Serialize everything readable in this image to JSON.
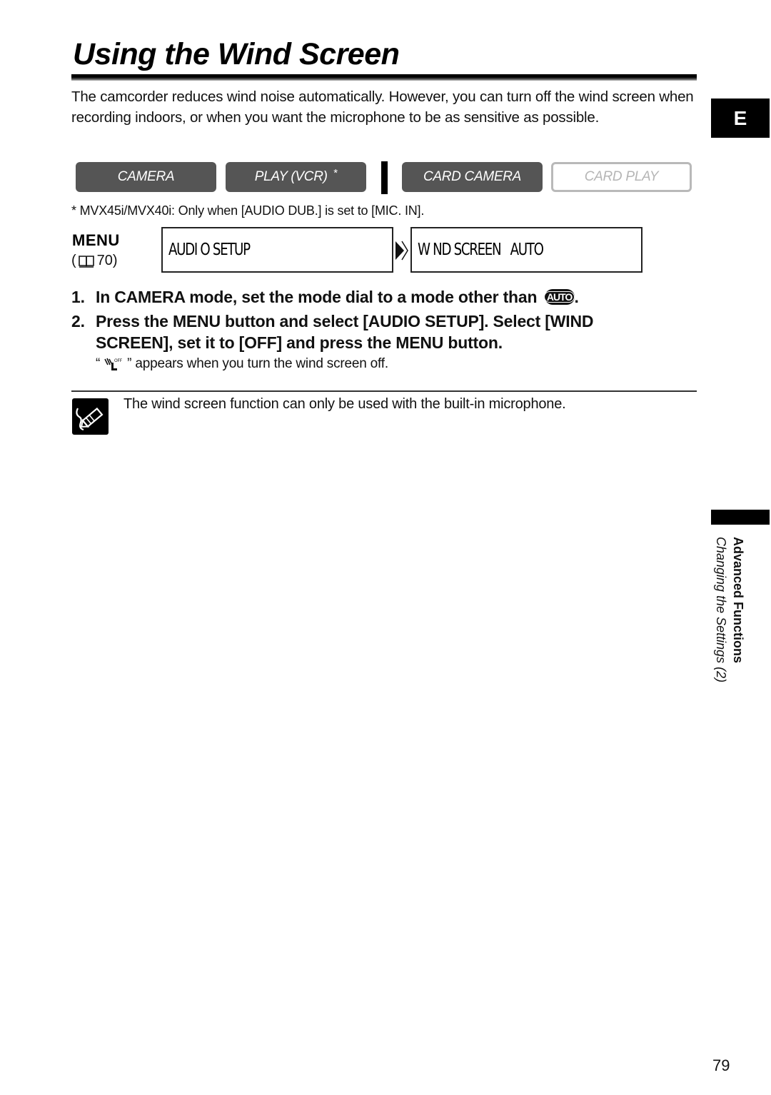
{
  "page": {
    "title": "Using the Wind Screen",
    "intro": "The camcorder reduces wind noise automatically. However, you can turn off the wind screen when recording indoors, or when you want the microphone to be as sensitive as possible.",
    "language_tab": "E",
    "page_number": "79"
  },
  "modes": {
    "items": [
      {
        "label": "CAMERA",
        "active": true,
        "icon": null
      },
      {
        "label": "PLAY (VCR)",
        "active": true,
        "suffix": "*"
      },
      {
        "label": "CARD CAMERA",
        "active": true
      },
      {
        "label": "CARD PLAY",
        "active": false
      }
    ],
    "footnote": "*  MVX45i/MVX40i: Only when [AUDIO DUB.] is set to [MIC. IN].",
    "colors": {
      "active_bg": "#555555",
      "active_text": "#ffffff",
      "inactive_border": "#b9b9b9",
      "inactive_text": "#b5b5b5"
    }
  },
  "menu": {
    "label": "MENU",
    "ref_open": "(",
    "ref_icon": "book-icon",
    "ref_page": "70)",
    "path": [
      {
        "text": "AUDI O SETUP"
      },
      {
        "text": "W ND SCREEN   AUTO"
      }
    ]
  },
  "steps": [
    {
      "num": "1.",
      "text": "In CAMERA mode, set the mode dial to a mode other than",
      "badge": "AUTO",
      "end": "."
    },
    {
      "num": "2.",
      "text": "Press the MENU button and select [AUDIO SETUP]. Select [WIND SCREEN], set it to [OFF] and press the MENU button."
    }
  ],
  "step_note": {
    "open_quote": "“",
    "icon": "wind-screen-off-icon",
    "rest": "” appears when you turn the wind screen off."
  },
  "note": {
    "icon": "note-pencil-icon",
    "text": "The wind screen function can only be used with the built-in microphone."
  },
  "sidebar": {
    "section": "Advanced Functions",
    "subsection": "Changing the Settings (2)"
  }
}
